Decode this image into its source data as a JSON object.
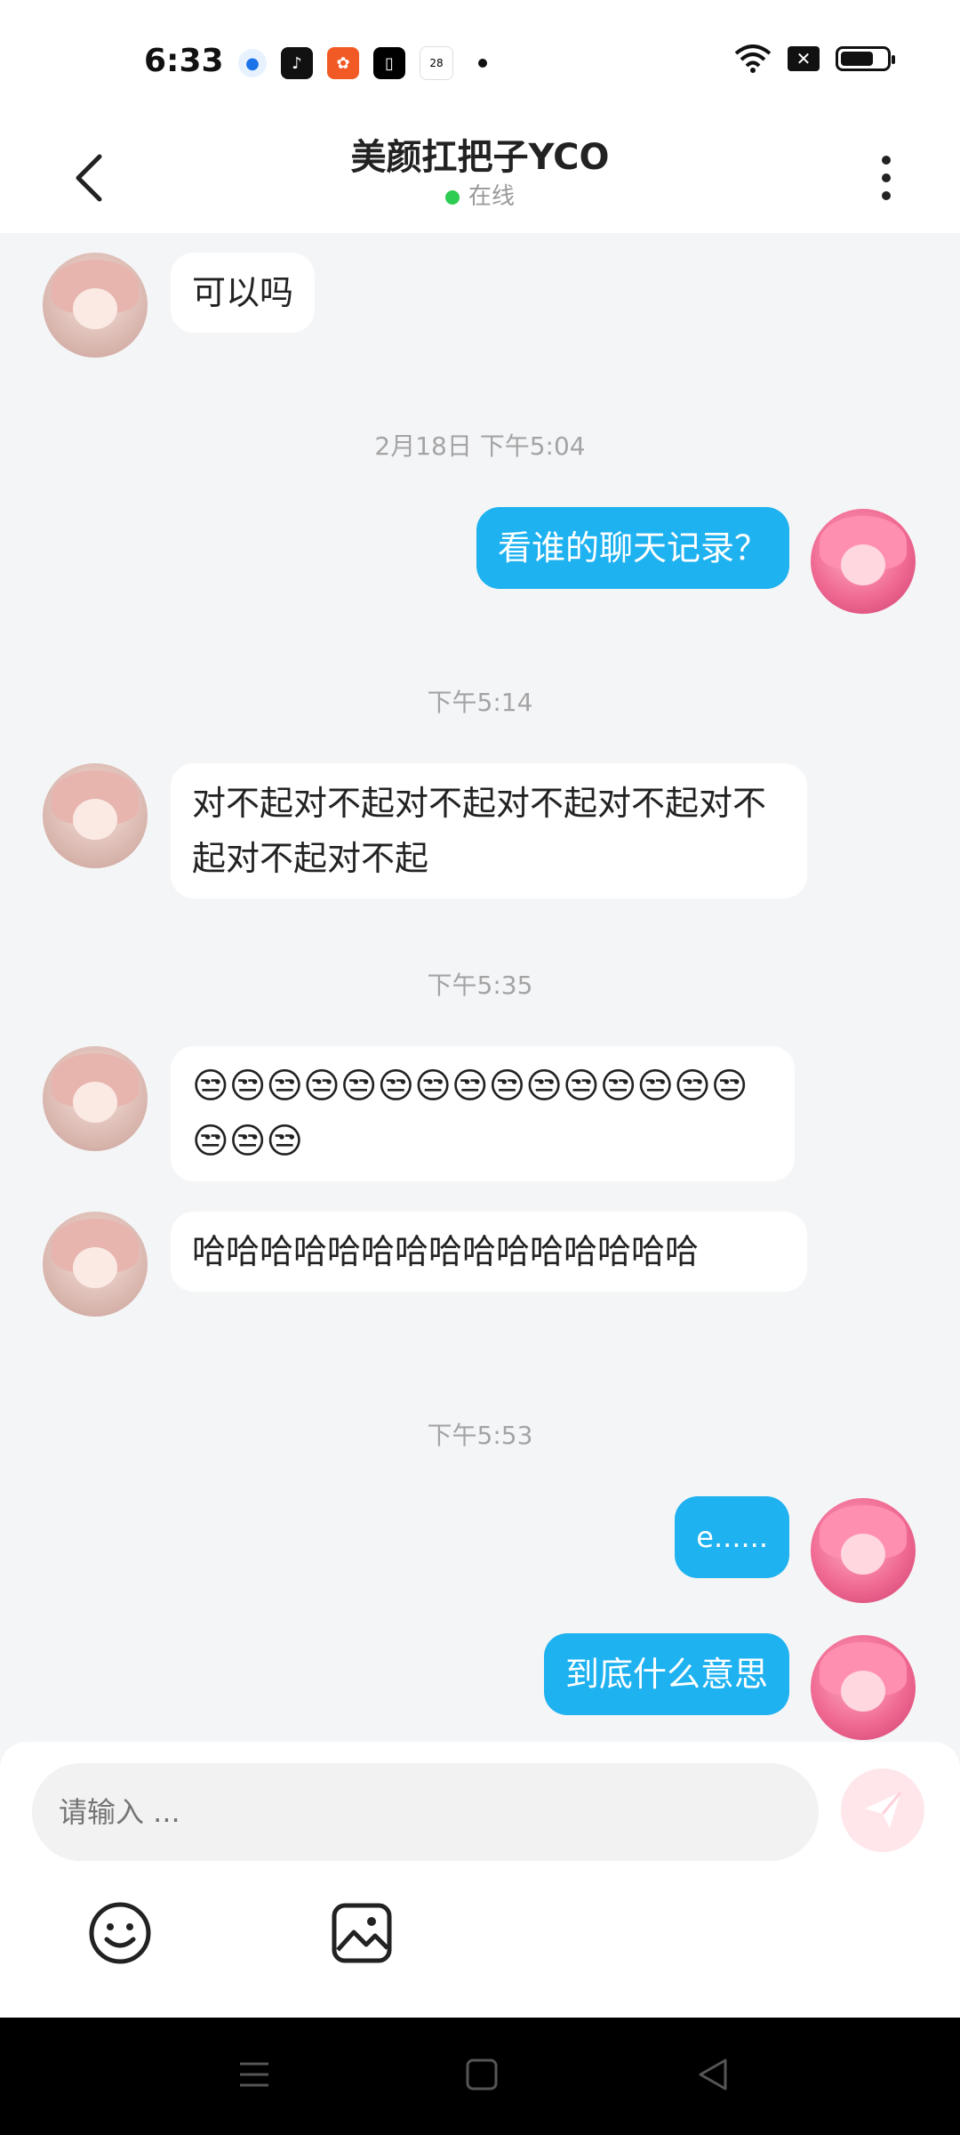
{
  "status_bar": {
    "time": "6:33",
    "calendar_icon_text": "28",
    "icons_left": [
      "blue-circle-app-icon",
      "tiktok-icon",
      "orange-app-icon",
      "black-app-icon",
      "calendar-icon"
    ],
    "icons_right": [
      "wifi-icon",
      "x-box-icon",
      "battery-icon"
    ]
  },
  "header": {
    "title": "美颜扛把子YCO",
    "status_text": "在线",
    "status_color": "#2ecc52"
  },
  "messages": [
    {
      "type": "other",
      "text": "可以吗"
    },
    {
      "type": "timestamp",
      "text": "2月18日 下午5:04"
    },
    {
      "type": "self",
      "text": "看谁的聊天记录？"
    },
    {
      "type": "timestamp",
      "text": "下午5:14"
    },
    {
      "type": "other",
      "text": "对不起对不起对不起对不起对不起对不起对不起对不起"
    },
    {
      "type": "timestamp",
      "text": "下午5:35"
    },
    {
      "type": "other",
      "text": "😒😒😒😒😒😒😒😒😒😒😒😒😒😒😒😒😒😒"
    },
    {
      "type": "other",
      "text": "哈哈哈哈哈哈哈哈哈哈哈哈哈哈哈"
    },
    {
      "type": "timestamp",
      "text": "下午5:53"
    },
    {
      "type": "self",
      "text": "e......"
    },
    {
      "type": "self",
      "text": "到底什么意思"
    }
  ],
  "input": {
    "placeholder": "请输入 ..."
  },
  "colors": {
    "self_bubble": "#1fb2f0",
    "other_bubble": "#ffffff",
    "background": "#f4f5f7",
    "send_button": "#ffe6ea"
  }
}
